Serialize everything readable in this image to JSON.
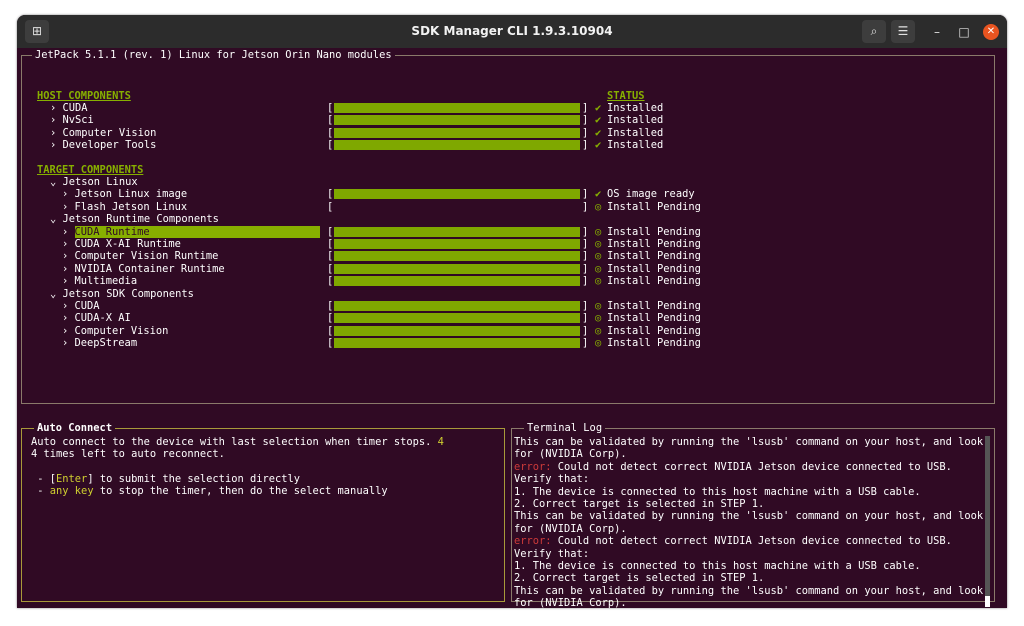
{
  "window": {
    "title": "SDK Manager CLI 1.9.3.10904"
  },
  "titlebar_icons": {
    "new_tab": "new-tab-icon",
    "search": "search-icon",
    "menu": "hamburger-menu-icon",
    "minimize": "minimize-icon",
    "maximize": "maximize-icon",
    "close": "close-icon"
  },
  "titlebar_glyphs": {
    "new_tab": "⊞",
    "search": "⌕",
    "menu": "☰",
    "minimize": "–",
    "maximize": "□",
    "close": "✕"
  },
  "main_panel": {
    "title": "JetPack 5.1.1 (rev. 1) Linux for Jetson Orin Nano modules",
    "host_header": "HOST COMPONENTS",
    "status_header": "STATUS",
    "target_header": "TARGET COMPONENTS"
  },
  "host_items": [
    {
      "label": "› CUDA",
      "progress": 1.0,
      "status": "Installed",
      "status_icon": "✔"
    },
    {
      "label": "› NvSci",
      "progress": 1.0,
      "status": "Installed",
      "status_icon": "✔"
    },
    {
      "label": "› Computer Vision",
      "progress": 1.0,
      "status": "Installed",
      "status_icon": "✔"
    },
    {
      "label": "› Developer Tools",
      "progress": 1.0,
      "status": "Installed",
      "status_icon": "✔"
    }
  ],
  "target_items": [
    {
      "label": "⌄ Jetson Linux",
      "group": true
    },
    {
      "label": "› Jetson Linux image",
      "progress": 1.0,
      "status": "OS image ready",
      "status_icon": "✔"
    },
    {
      "label": "› Flash Jetson Linux",
      "progress": 0.0,
      "status": "Install Pending",
      "status_icon": "◎"
    },
    {
      "label": "⌄ Jetson Runtime Components",
      "group": true
    },
    {
      "label": "CUDA Runtime",
      "prefix": "› ",
      "selected": true,
      "progress": 1.0,
      "status": "Install Pending",
      "status_icon": "◎"
    },
    {
      "label": "› CUDA X-AI Runtime",
      "progress": 1.0,
      "status": "Install Pending",
      "status_icon": "◎"
    },
    {
      "label": "› Computer Vision Runtime",
      "progress": 1.0,
      "status": "Install Pending",
      "status_icon": "◎"
    },
    {
      "label": "› NVIDIA Container Runtime",
      "progress": 1.0,
      "status": "Install Pending",
      "status_icon": "◎"
    },
    {
      "label": "› Multimedia",
      "progress": 1.0,
      "status": "Install Pending",
      "status_icon": "◎"
    },
    {
      "label": "⌄ Jetson SDK Components",
      "group": true
    },
    {
      "label": "› CUDA",
      "progress": 1.0,
      "status": "Install Pending",
      "status_icon": "◎"
    },
    {
      "label": "› CUDA-X AI",
      "progress": 1.0,
      "status": "Install Pending",
      "status_icon": "◎"
    },
    {
      "label": "› Computer Vision",
      "progress": 1.0,
      "status": "Install Pending",
      "status_icon": "◎"
    },
    {
      "label": "› DeepStream",
      "progress": 1.0,
      "status": "Install Pending",
      "status_icon": "◎"
    }
  ],
  "auto_connect": {
    "title": "Auto Connect",
    "line1": "Auto connect to the device with last selection when timer stops.",
    "timer": "4",
    "line2": "4 times left to auto reconnect.",
    "opt1_dash": " - [",
    "opt1_key": "Enter",
    "opt1_rest": "] to submit the selection directly",
    "opt2_dash": " - ",
    "opt2_key": "any key",
    "opt2_rest": " to stop the timer, then do the select manually"
  },
  "terminal_log": {
    "title": "Terminal Log",
    "lines": [
      {
        "text": "This can be validated by running the 'lsusb' command on your host, and look"
      },
      {
        "text": "for (NVIDIA Corp)."
      },
      {
        "prefix": "error:",
        "text": " Could not detect correct NVIDIA Jetson device connected to USB."
      },
      {
        "text": "Verify that:"
      },
      {
        "text": "1. The device is connected to this host machine with a USB cable."
      },
      {
        "text": "2. Correct target is selected in STEP 1."
      },
      {
        "text": "This can be validated by running the 'lsusb' command on your host, and look"
      },
      {
        "text": "for (NVIDIA Corp)."
      },
      {
        "prefix": "error:",
        "text": " Could not detect correct NVIDIA Jetson device connected to USB."
      },
      {
        "text": "Verify that:"
      },
      {
        "text": "1. The device is connected to this host machine with a USB cable."
      },
      {
        "text": "2. Correct target is selected in STEP 1."
      },
      {
        "text": "This can be validated by running the 'lsusb' command on your host, and look"
      },
      {
        "text": "for (NVIDIA Corp)."
      }
    ]
  },
  "colors": {
    "background": "#300a24",
    "accent": "#87af00",
    "error": "#cd3a3a",
    "highlight": "#cfcf30"
  }
}
